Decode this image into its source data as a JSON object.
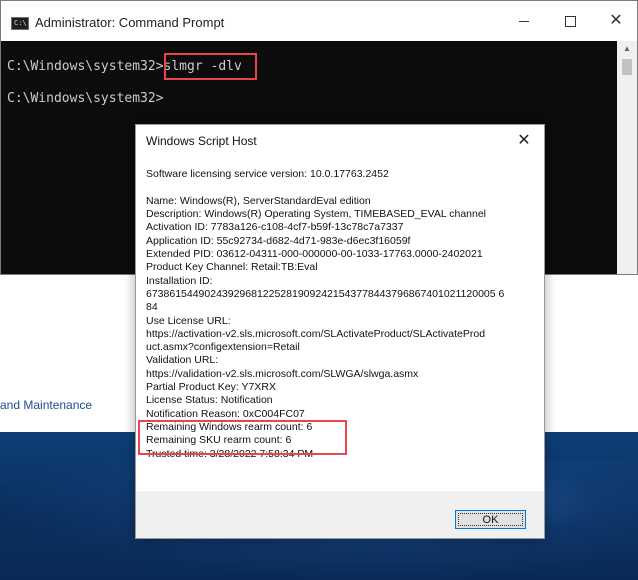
{
  "cmd": {
    "title": "Administrator: Command Prompt",
    "icon_label": "C:\\",
    "lines": [
      "C:\\Windows\\system32>slmgr -dlv",
      "C:\\Windows\\system32>"
    ]
  },
  "background": {
    "partial_text": "and Maintenance"
  },
  "dialog": {
    "title": "Windows Script Host",
    "lines": [
      "",
      "Software licensing service version: 10.0.17763.2452",
      "",
      "Name: Windows(R), ServerStandardEval edition",
      "Description: Windows(R) Operating System, TIMEBASED_EVAL channel",
      "Activation ID: 7783a126-c108-4cf7-b59f-13c78c7a7337",
      "Application ID: 55c92734-d682-4d71-983e-d6ec3f16059f",
      "Extended PID: 03612-04311-000-000000-00-1033-17763.0000-2402021",
      "Product Key Channel: Retail:TB:Eval",
      "Installation ID:",
      "673861544902439296812252819092421543778443796867401021120005 6",
      "84",
      "Use License URL:",
      "https://activation-v2.sls.microsoft.com/SLActivateProduct/SLActivateProd",
      "uct.asmx?configextension=Retail",
      "Validation URL:",
      "https://validation-v2.sls.microsoft.com/SLWGA/slwga.asmx",
      "Partial Product Key: Y7XRX",
      "License Status: Notification",
      "Notification Reason: 0xC004FC07",
      "Remaining Windows rearm count: 6",
      "Remaining SKU rearm count: 6",
      "Trusted time: 3/28/2022 7:58:34 PM"
    ],
    "ok_label": "OK"
  },
  "colors": {
    "highlight": "#e8454e",
    "console_bg": "#0c0c0c",
    "console_text": "#cccccc",
    "desktop": "#0e3f78"
  }
}
